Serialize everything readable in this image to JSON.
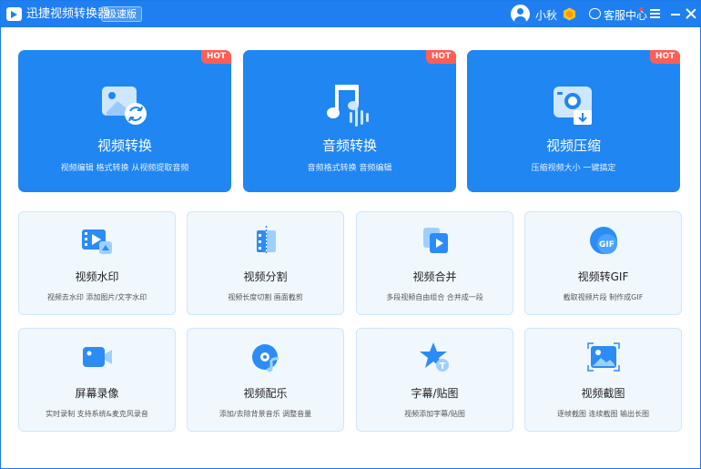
{
  "header": {
    "app_title": "迅捷视频转换器",
    "edition": "极速版",
    "username": "小秋",
    "service_label": "客服中心"
  },
  "feature_cards": [
    {
      "title": "视频转换",
      "desc": "视频编辑 格式转换 从视频提取音频",
      "badge": "HOT",
      "icon": "video-convert-icon"
    },
    {
      "title": "音频转换",
      "desc": "音频格式转换 音频编辑",
      "badge": "HOT",
      "icon": "audio-convert-icon"
    },
    {
      "title": "视频压缩",
      "desc": "压缩视频大小 一键搞定",
      "badge": "HOT",
      "icon": "video-compress-icon"
    }
  ],
  "tools": [
    {
      "title": "视频水印",
      "desc": "视频去水印 添加图片/文字水印",
      "icon": "video-watermark-icon"
    },
    {
      "title": "视频分割",
      "desc": "视频长度切割 画面截剪",
      "icon": "video-split-icon"
    },
    {
      "title": "视频合并",
      "desc": "多段视频自由组合 合并成一段",
      "icon": "video-merge-icon"
    },
    {
      "title": "视频转GIF",
      "desc": "截取视频片段 制作成GIF",
      "icon": "video-to-gif-icon"
    },
    {
      "title": "屏幕录像",
      "desc": "实时录制 支持系统&麦克风录音",
      "icon": "screen-record-icon"
    },
    {
      "title": "视频配乐",
      "desc": "添加/去除背景音乐 调整音量",
      "icon": "video-music-icon"
    },
    {
      "title": "字幕/贴图",
      "desc": "视频添加字幕/贴图",
      "icon": "subtitle-sticker-icon"
    },
    {
      "title": "视频截图",
      "desc": "逐帧截图 连续截图 输出长图",
      "icon": "video-screenshot-icon"
    }
  ],
  "colors": {
    "titlebar": "#1f7ff0",
    "card_blue": "#1f86f2",
    "hot_badge": "#ff5e57",
    "tool_card_bg": "#f0f8fe"
  }
}
